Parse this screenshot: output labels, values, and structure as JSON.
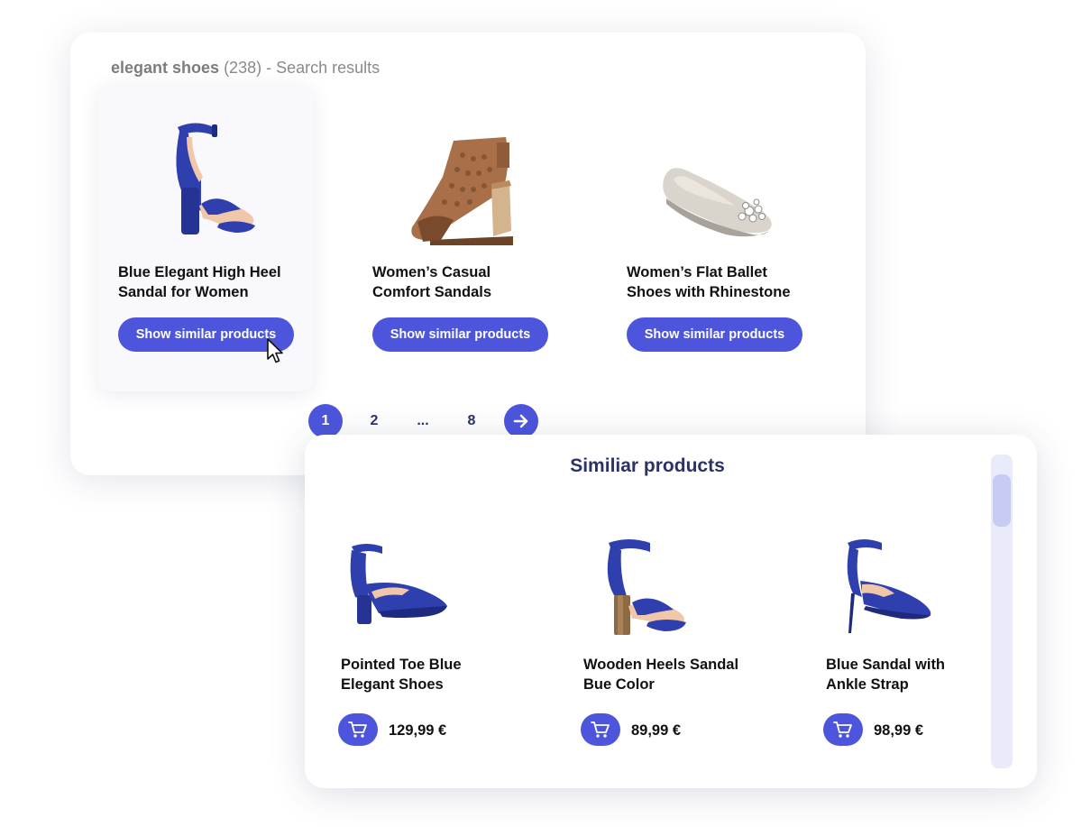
{
  "search": {
    "query": "elegant shoes",
    "count": "(238)",
    "suffix": "- Search results"
  },
  "products": [
    {
      "title_line1": "Blue Elegant High Heel",
      "title_line2": "Sandal for Women",
      "button_label": "Show similar products"
    },
    {
      "title_line1": "Women’s Casual",
      "title_line2": "Comfort Sandals",
      "button_label": "Show similar products"
    },
    {
      "title_line1": "Women’s Flat Ballet",
      "title_line2": "Shoes with Rhinestone",
      "button_label": "Show similar products"
    }
  ],
  "pagination": {
    "pages": [
      "1",
      "2",
      "...",
      "8"
    ],
    "current": "1",
    "next_icon": "arrow-right-icon"
  },
  "similar": {
    "title": "Similiar products",
    "items": [
      {
        "title_line1": "Pointed Toe Blue",
        "title_line2": "Elegant Shoes",
        "price": "129,99 €",
        "cart_icon": "cart-icon"
      },
      {
        "title_line1": "Wooden Heels Sandal",
        "title_line2": "Bue Color",
        "price": "89,99 €",
        "cart_icon": "cart-icon"
      },
      {
        "title_line1": "Blue Sandal with",
        "title_line2": "Ankle Strap",
        "price": "98,99 €",
        "cart_icon": "cart-icon"
      }
    ]
  },
  "colors": {
    "accent": "#4d55dc",
    "heading": "#2d3266",
    "shoe_blue": "#2f3fae",
    "shoe_tan": "#a86f48",
    "shoe_silver": "#d9d5cc",
    "scrollbar_track": "#e9ebfb",
    "scrollbar_thumb": "#c7ccf5"
  }
}
